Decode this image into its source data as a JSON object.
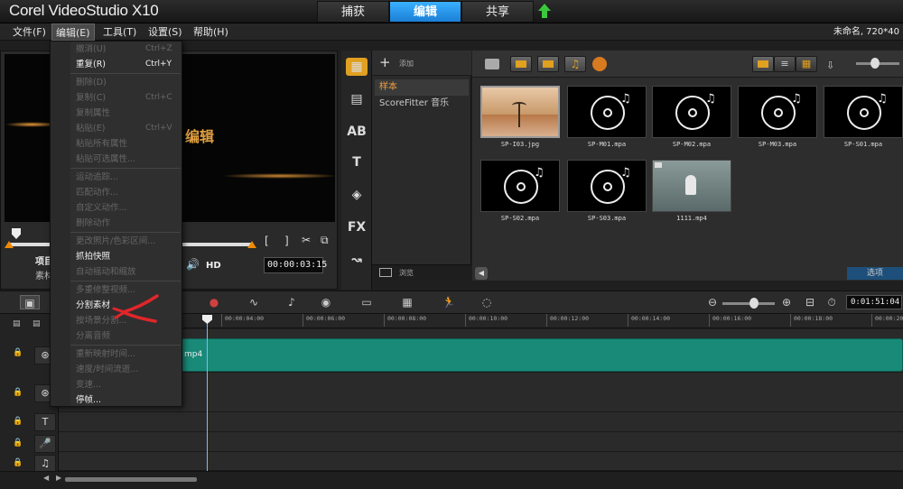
{
  "app": {
    "title": "Corel VideoStudio X10",
    "project_info": "未命名, 720*40"
  },
  "tabs": [
    {
      "label": "捕获",
      "active": false
    },
    {
      "label": "编辑",
      "active": true
    },
    {
      "label": "共享",
      "active": false
    }
  ],
  "menubar": [
    "文件(F)",
    "编辑(E)",
    "工具(T)",
    "设置(S)",
    "帮助(H)"
  ],
  "edit_menu": {
    "items": [
      {
        "label": "撤消(U)",
        "shortcut": "Ctrl+Z",
        "enabled": false
      },
      {
        "label": "重复(R)",
        "shortcut": "Ctrl+Y",
        "enabled": true
      },
      {
        "label": "删除(D)",
        "shortcut": "",
        "enabled": false
      },
      {
        "label": "复制(C)",
        "shortcut": "Ctrl+C",
        "enabled": false
      },
      {
        "label": "复制属性",
        "shortcut": "",
        "enabled": false
      },
      {
        "label": "粘贴(E)",
        "shortcut": "Ctrl+V",
        "enabled": false
      },
      {
        "label": "粘贴所有属性",
        "shortcut": "",
        "enabled": false
      },
      {
        "label": "粘贴可选属性...",
        "shortcut": "",
        "enabled": false
      },
      {
        "label": "运动追踪...",
        "shortcut": "",
        "enabled": false
      },
      {
        "label": "匹配动作...",
        "shortcut": "",
        "enabled": false
      },
      {
        "label": "自定义动作...",
        "shortcut": "",
        "enabled": false
      },
      {
        "label": "删除动作",
        "shortcut": "",
        "enabled": false
      },
      {
        "label": "更改照片/色彩区间...",
        "shortcut": "",
        "enabled": false
      },
      {
        "label": "抓拍快照",
        "shortcut": "",
        "enabled": true
      },
      {
        "label": "自动摇动和缩放",
        "shortcut": "",
        "enabled": false
      },
      {
        "label": "多重修整视频...",
        "shortcut": "",
        "enabled": false
      },
      {
        "label": "分割素材",
        "shortcut": "",
        "enabled": true
      },
      {
        "label": "按场景分割...",
        "shortcut": "",
        "enabled": false
      },
      {
        "label": "分离音频",
        "shortcut": "",
        "enabled": false
      },
      {
        "label": "重新映射时间...",
        "shortcut": "",
        "enabled": false
      },
      {
        "label": "速度/时间流逝...",
        "shortcut": "",
        "enabled": false
      },
      {
        "label": "变速...",
        "shortcut": "",
        "enabled": false
      },
      {
        "label": "停帧...",
        "shortcut": "",
        "enabled": true
      }
    ]
  },
  "preview": {
    "overlay_text": "编辑",
    "project_label": "项目",
    "clip_label": "素材",
    "hd_label": "HD",
    "timecode": "00:00:03:15"
  },
  "library": {
    "add_label": "添加",
    "folders": [
      {
        "label": "样本",
        "selected": true
      },
      {
        "label": "ScoreFitter 音乐",
        "selected": false
      }
    ],
    "browse_label": "浏览",
    "options_label": "选项",
    "items": [
      {
        "caption": "SP-I03.jpg",
        "kind": "image"
      },
      {
        "caption": "SP-M01.mpa",
        "kind": "audio"
      },
      {
        "caption": "SP-M02.mpa",
        "kind": "audio"
      },
      {
        "caption": "SP-M03.mpa",
        "kind": "audio"
      },
      {
        "caption": "SP-S01.mpa",
        "kind": "audio"
      },
      {
        "caption": "SP-S02.mpa",
        "kind": "audio"
      },
      {
        "caption": "SP-S03.mpa",
        "kind": "audio"
      },
      {
        "caption": "1111.mp4",
        "kind": "video"
      }
    ]
  },
  "timeline": {
    "timecode": "0:01:51:04",
    "ruler": [
      "00:00:04:00",
      "00:00:06:00",
      "00:00:08:00",
      "00:00:10:00",
      "00:00:12:00",
      "00:00:14:00",
      "00:00:16:00",
      "00:00:18:00",
      "00:00:20:0"
    ],
    "clip_name": "mp4"
  },
  "colors": {
    "accent_tab": "#2a95ee",
    "clip": "#198a78",
    "annotation": "#e0262a"
  }
}
